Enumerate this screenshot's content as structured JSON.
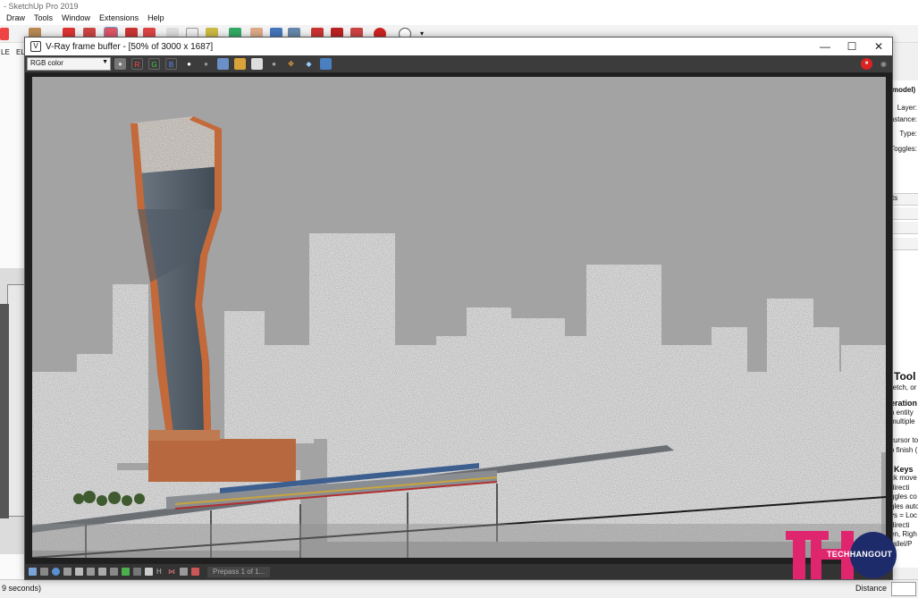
{
  "app": {
    "title": "- SketchUp Pro 2019",
    "menu": [
      "Draw",
      "Tools",
      "Window",
      "Extensions",
      "Help"
    ],
    "left_tabs": [
      "LE",
      "EL"
    ],
    "status_left": "9 seconds)",
    "status_distance_label": "Distance"
  },
  "entity_panel": {
    "title": "model)",
    "fields": [
      "Layer:",
      "Instance:",
      "Type:",
      "Toggles:"
    ],
    "section": "ts",
    "tool_title": "Tool",
    "tool_sub": "retch, or",
    "help_lines": [
      "eration",
      "n entity",
      "multiple",
      "",
      "cursor to",
      "o finish (",
      "",
      "Keys",
      "ck move",
      "directi",
      "ggles co",
      "gles auto",
      "ys = Loc",
      "directi",
      "en, Righ",
      "rallel/P"
    ]
  },
  "vfb": {
    "title": "V-Ray frame buffer - [50% of 3000 x 1687]",
    "channel": "RGB color",
    "rgb_buttons": [
      "R",
      "G",
      "B"
    ],
    "win_controls": {
      "minimize": "—",
      "maximize": "☐",
      "close": "✕"
    },
    "prepass_status": "Prepass 1 of 1..."
  },
  "watermark": {
    "logo_letters": "TH",
    "brand": "TECHHANGOUT"
  },
  "colors": {
    "render_sky": "#a3a3a3",
    "tower_copper": "#c46a3a",
    "vfb_chrome": "#3c3c3c",
    "watermark_pink": "#e0256f",
    "watermark_navy": "#1d2b6b"
  }
}
